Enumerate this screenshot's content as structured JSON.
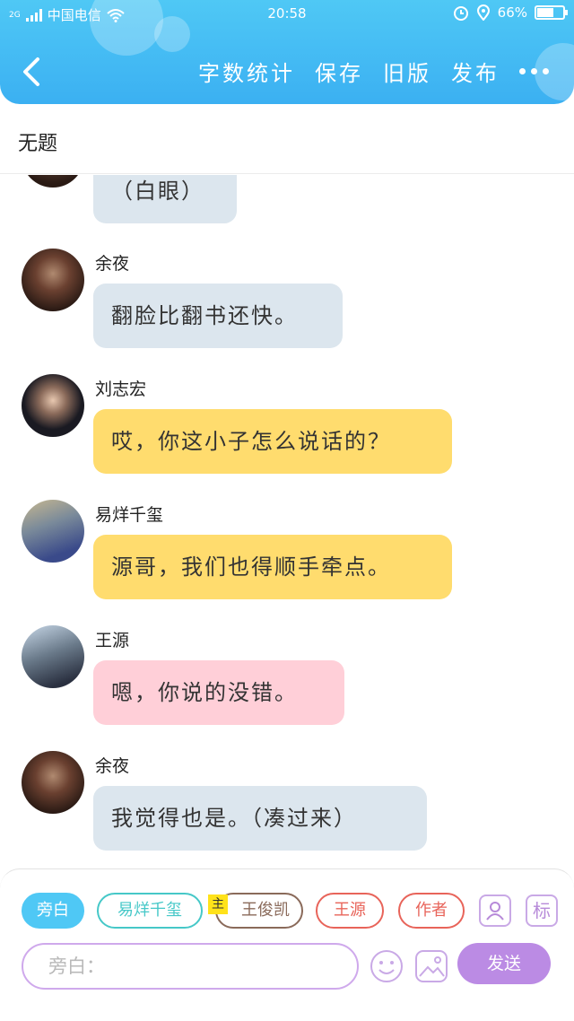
{
  "status": {
    "carrier": "中国电信",
    "network": "2G",
    "time": "20:58",
    "battery": "66%",
    "battery_level": 0.66
  },
  "header": {
    "back_icon": "chevron-left-icon",
    "actions": [
      "字数统计",
      "保存",
      "旧版",
      "发布"
    ],
    "more_icon": "more-dots-icon"
  },
  "title": "无题",
  "messages": [
    {
      "sender": "",
      "text": "（白眼）",
      "color": "#dce6ee"
    },
    {
      "sender": "余夜",
      "text": "翻脸比翻书还快。",
      "color": "#dce6ee"
    },
    {
      "sender": "刘志宏",
      "text": "哎，你这小子怎么说话的？",
      "color": "#ffdc6e"
    },
    {
      "sender": "易烊千玺",
      "text": "源哥，我们也得顺手牵点。",
      "color": "#ffdc6e"
    },
    {
      "sender": "王源",
      "text": "嗯，你说的没错。",
      "color": "#ffcfd8"
    },
    {
      "sender": "余夜",
      "text": "我觉得也是。（凑过来）",
      "color": "#dce6ee"
    }
  ],
  "roles": [
    {
      "label": "旁白",
      "color": "#4fc8f5",
      "selected": true
    },
    {
      "label": "易烊千玺",
      "color": "#46c8c8",
      "selected": false
    },
    {
      "label": "王俊凯",
      "color": "#8a6a5a",
      "selected": false
    },
    {
      "label": "王源",
      "color": "#e8645a",
      "selected": false
    },
    {
      "label": "作者",
      "color": "#e8645a",
      "selected": false
    }
  ],
  "main_badge": "主",
  "tools": {
    "profile_icon": "user-card-icon",
    "tag_label": "标"
  },
  "input": {
    "placeholder": "旁白："
  },
  "emoji_icon": "smiley-icon",
  "image_icon": "image-icon",
  "send_label": "发送"
}
